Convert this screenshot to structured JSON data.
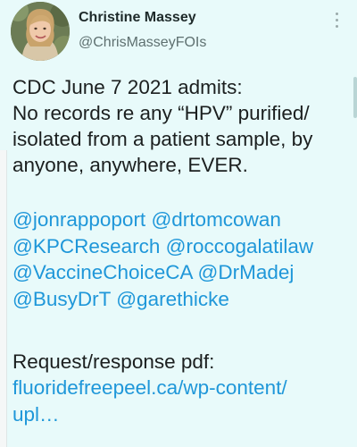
{
  "author": {
    "name": "Christine Massey",
    "handle": "@ChrisMasseyFOIs"
  },
  "tweet": {
    "text_lines": [
      "CDC June 7 2021 admits:",
      "No records re any “HPV” purified/",
      "isolated from a patient sample, by",
      "anyone, anywhere, EVER."
    ],
    "mentions": [
      "@jonrappoport",
      "@drtomcowan",
      "@KPCResearch",
      "@roccogalatilaw",
      "@VaccineChoiceCA",
      "@DrMadej",
      "@BusyDrT",
      "@garethicke"
    ],
    "request_label": "Request/response pdf:",
    "link_lines": [
      "fluoridefreepeel.ca/wp-content/",
      "upl…"
    ]
  },
  "icons": {
    "avatar": "profile-photo",
    "menu": "more-vertical-icon"
  },
  "colors": {
    "background": "#e8fafa",
    "link": "#1f97d9",
    "text": "#1b1f1f",
    "secondary_text": "#5e7070"
  }
}
